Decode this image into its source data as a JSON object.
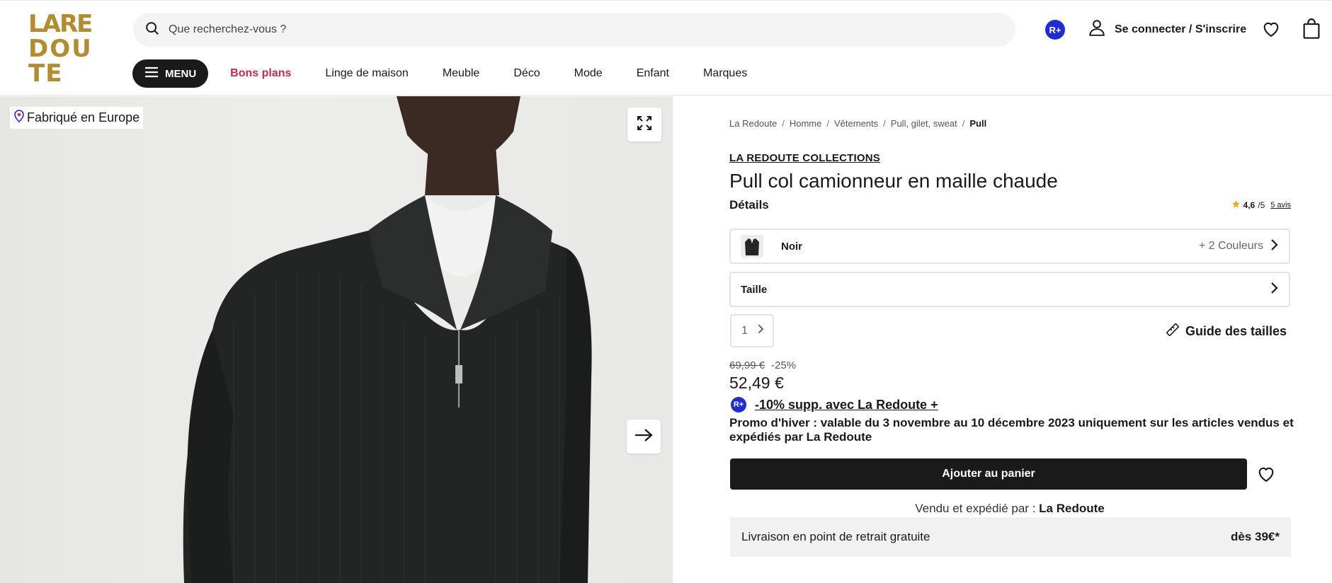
{
  "header": {
    "logo_text": "LA REDOUTE",
    "search_placeholder": "Que recherchez-vous ?",
    "rplus_badge": "R+",
    "login_label": "Se connecter / S'inscrire"
  },
  "nav": {
    "menu_label": "MENU",
    "items": [
      {
        "label": "Bons plans"
      },
      {
        "label": "Linge de maison"
      },
      {
        "label": "Meuble"
      },
      {
        "label": "Déco"
      },
      {
        "label": "Mode"
      },
      {
        "label": "Enfant"
      },
      {
        "label": "Marques"
      }
    ]
  },
  "media": {
    "badge_label": "Fabriqué en Europe"
  },
  "breadcrumb": [
    "La Redoute",
    "Homme",
    "Vêtements",
    "Pull, gilet, sweat",
    "Pull"
  ],
  "product": {
    "brand": "LA REDOUTE COLLECTIONS",
    "title": "Pull col camionneur en maille chaude",
    "details_label": "Détails",
    "rating": {
      "score": "4,6",
      "out_of": "/5",
      "reviews": "5 avis"
    },
    "color": {
      "selected": "Noir",
      "more": "+ 2 Couleurs"
    },
    "size_label": "Taille",
    "quantity": "1",
    "size_guide": "Guide des tailles",
    "price": {
      "old": "69,99 €",
      "discount": "-25%",
      "current": "52,49 €"
    },
    "rplus_offer": "-10% supp. avec La Redoute +",
    "promo": "Promo d'hiver : valable du 3 novembre au 10 décembre 2023 uniquement sur les articles vendus et expédiés par La Redoute",
    "add_to_cart": "Ajouter au panier",
    "seller_prefix": "Vendu et expédié par :",
    "seller_name": "La Redoute",
    "delivery_label": "Livraison en point de retrait gratuite",
    "delivery_amount": "dès 39€*"
  },
  "colors": {
    "brand_gold": "#b38c2f",
    "promo_red": "#c8294c",
    "rplus_blue": "#1f2bd6",
    "star": "#f2a81d"
  }
}
